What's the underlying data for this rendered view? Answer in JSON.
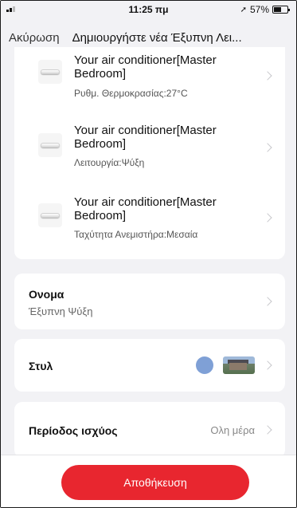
{
  "status_bar": {
    "time": "11:25 πμ",
    "battery": "57%",
    "battery_level": 0.57,
    "location_icon": "location-arrow-icon"
  },
  "nav": {
    "cancel_label": "Ακύρωση",
    "title": "Δημιουργήστε νέα Έξυπνη Λει..."
  },
  "actions": [
    {
      "title": "Your air conditioner[Master Bedroom]",
      "subtitle": "Ρυθμ. Θερμοκρασίας:27°C"
    },
    {
      "title": "Your air conditioner[Master Bedroom]",
      "subtitle": "Λειτουργία:Ψύξη"
    },
    {
      "title": "Your air conditioner[Master Bedroom]",
      "subtitle": "Ταχύτητα Ανεμιστήρα:Μεσαία"
    }
  ],
  "name_setting": {
    "label": "Ονομα",
    "value": "Έξυπνη Ψύξη"
  },
  "style_setting": {
    "label": "Στυλ",
    "color": "#7fa0d6"
  },
  "period_setting": {
    "label": "Περίοδος ισχύος",
    "value": "Ολη μέρα"
  },
  "footer": {
    "save_label": "Αποθήκευση"
  },
  "colors": {
    "accent": "#e8262f",
    "background": "#f2f2f5",
    "card": "#ffffff"
  }
}
